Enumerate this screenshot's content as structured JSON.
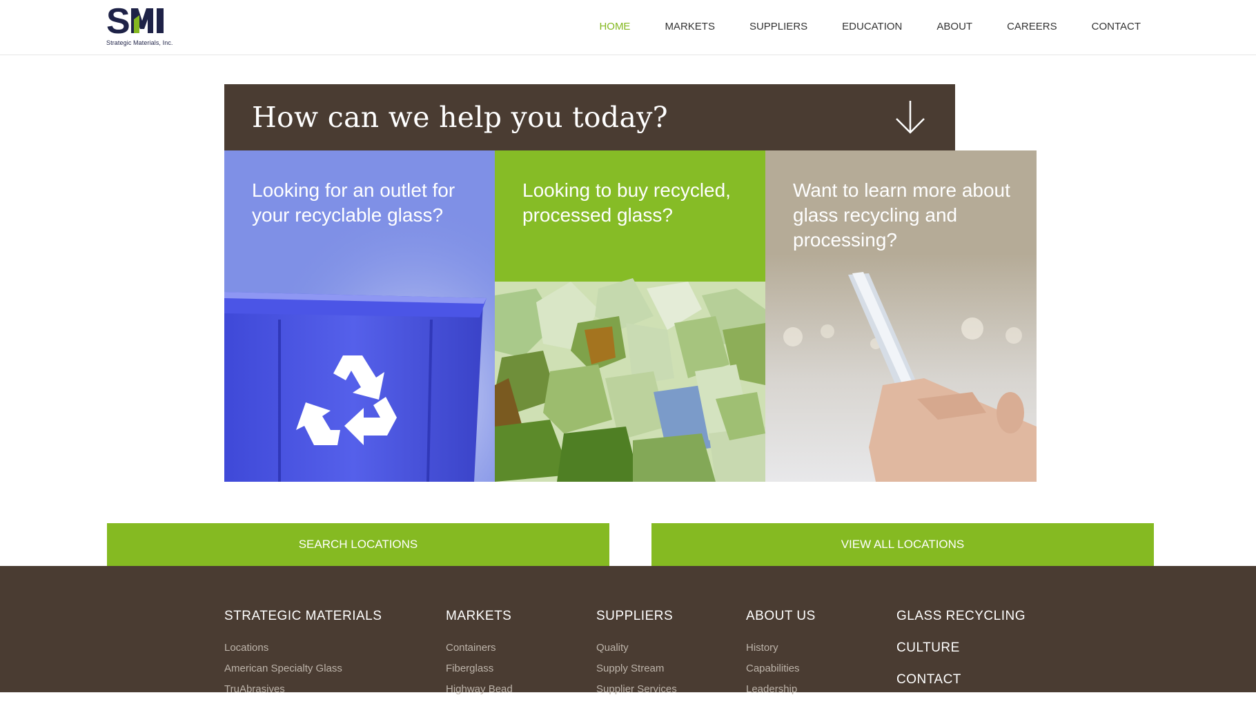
{
  "header": {
    "logo_text": "SMI",
    "logo_subtitle": "Strategic Materials, Inc.",
    "nav": [
      {
        "label": "HOME",
        "active": true
      },
      {
        "label": "MARKETS",
        "active": false
      },
      {
        "label": "SUPPLIERS",
        "active": false
      },
      {
        "label": "EDUCATION",
        "active": false
      },
      {
        "label": "ABOUT",
        "active": false
      },
      {
        "label": "CAREERS",
        "active": false
      },
      {
        "label": "CONTACT",
        "active": false
      }
    ]
  },
  "hero": {
    "title": "How can we help you today?",
    "panels": [
      {
        "pre": "Looking for ",
        "bold": "an outlet for your recyclable glass?"
      },
      {
        "pre": "Looking to ",
        "bold": "buy recycled, processed glass?"
      },
      {
        "pre": "Want to learn more ",
        "bold": "about glass recycling and processing?"
      }
    ]
  },
  "buttons": {
    "search": "SEARCH LOCATIONS",
    "view_all": "VIEW ALL LOCATIONS"
  },
  "footer": {
    "columns": [
      {
        "heading": "STRATEGIC MATERIALS",
        "links": [
          "Locations",
          "American Specialty Glass",
          "TruAbrasives"
        ]
      },
      {
        "heading": "MARKETS",
        "links": [
          "Containers",
          "Fiberglass",
          "Highway Bead"
        ]
      },
      {
        "heading": "SUPPLIERS",
        "links": [
          "Quality",
          "Supply Stream",
          "Supplier Services"
        ]
      },
      {
        "heading": "ABOUT US",
        "links": [
          "History",
          "Capabilities",
          "Leadership"
        ]
      }
    ],
    "stack_headings": [
      "GLASS RECYCLING",
      "CULTURE",
      "CONTACT"
    ]
  },
  "colors": {
    "accent_green": "#84b820",
    "brown": "#4a3c32",
    "panel_blue": "#7f90e6",
    "panel_tan": "#b5ab97",
    "navy": "#1e2247"
  }
}
